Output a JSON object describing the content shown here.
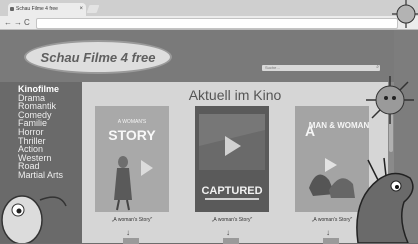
{
  "browser": {
    "tab_title": "Schau Filme 4 free",
    "nav_icons": [
      "back-icon",
      "forward-icon",
      "reload-icon"
    ]
  },
  "site": {
    "logo": "Schau Filme 4 free",
    "search_placeholder": "Suche…"
  },
  "sidebar": {
    "items": [
      {
        "label": "Kinofilme",
        "active": true
      },
      {
        "label": "Drama"
      },
      {
        "label": "Romantik"
      },
      {
        "label": "Comedy"
      },
      {
        "label": "Familie"
      },
      {
        "label": "Horror"
      },
      {
        "label": "Thriller"
      },
      {
        "label": "Action"
      },
      {
        "label": "Western"
      },
      {
        "label": "Road"
      },
      {
        "label": "Martial Arts"
      }
    ]
  },
  "main": {
    "heading": "Aktuell im Kino",
    "movies": [
      {
        "poster_top": "A WOMAN'S",
        "poster_title": "STORY",
        "caption": "„A woman's Story\""
      },
      {
        "poster_top": "",
        "poster_title": "CAPTURED",
        "caption": "„A woman's Story\""
      },
      {
        "poster_top": "A",
        "poster_title": "MAN & WOMAN",
        "caption": "„A woman's Story\""
      }
    ]
  },
  "colors": {
    "page_bg": "#6d6d6d",
    "content_bg": "#d6d6d6",
    "logo_bg": "#dedede"
  }
}
